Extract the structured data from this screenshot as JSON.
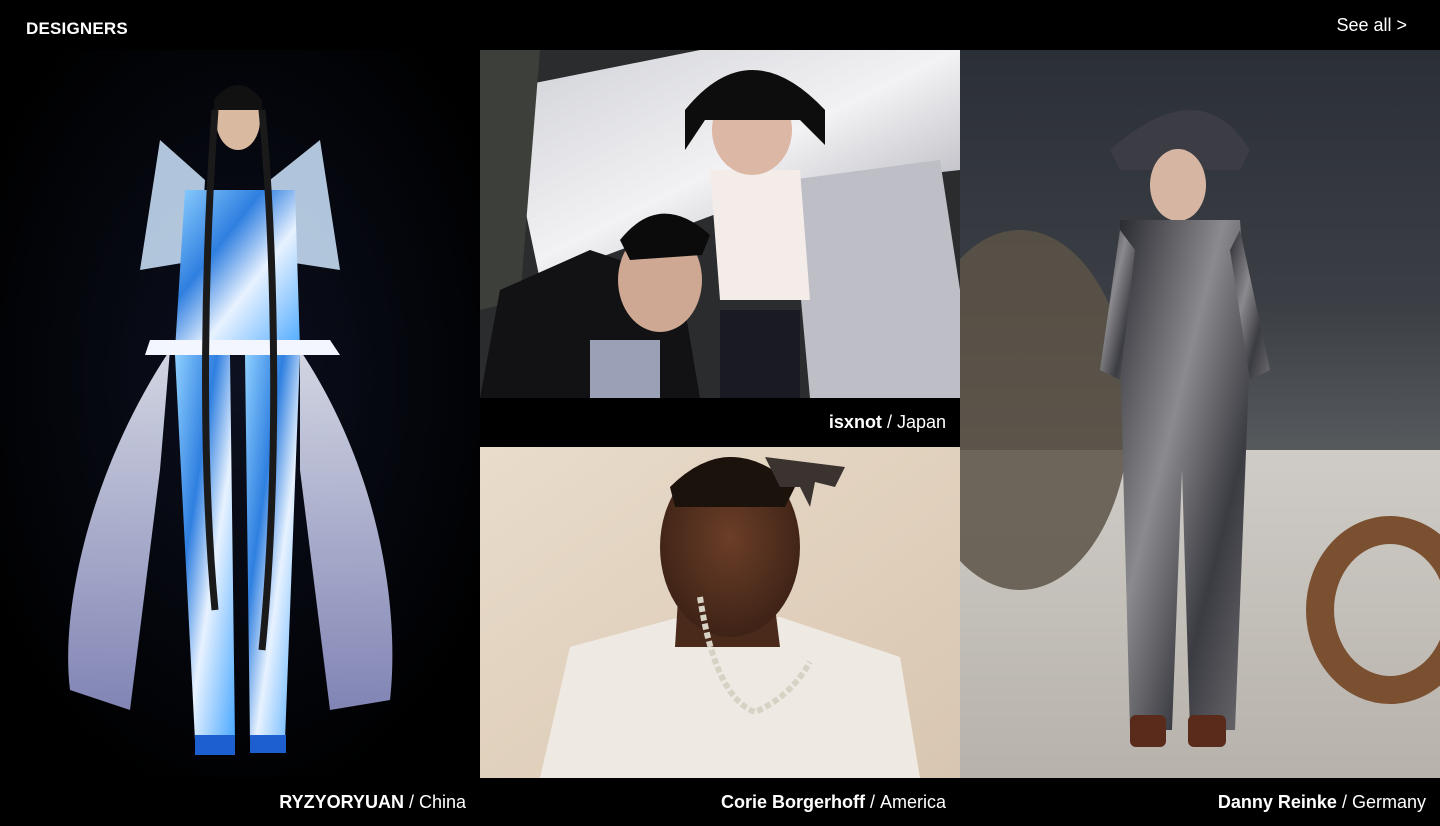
{
  "section": {
    "title": "DESIGNERS",
    "see_all_label": "See all >"
  },
  "designers": [
    {
      "name": "RYZYORYUAN",
      "country": "China"
    },
    {
      "name": "isxnot",
      "country": "Japan"
    },
    {
      "name": "Corie Borgerhoff",
      "country": "America"
    },
    {
      "name": "Danny Reinke",
      "country": "Germany"
    }
  ],
  "colors": {
    "background": "#000000",
    "text": "#ffffff"
  }
}
